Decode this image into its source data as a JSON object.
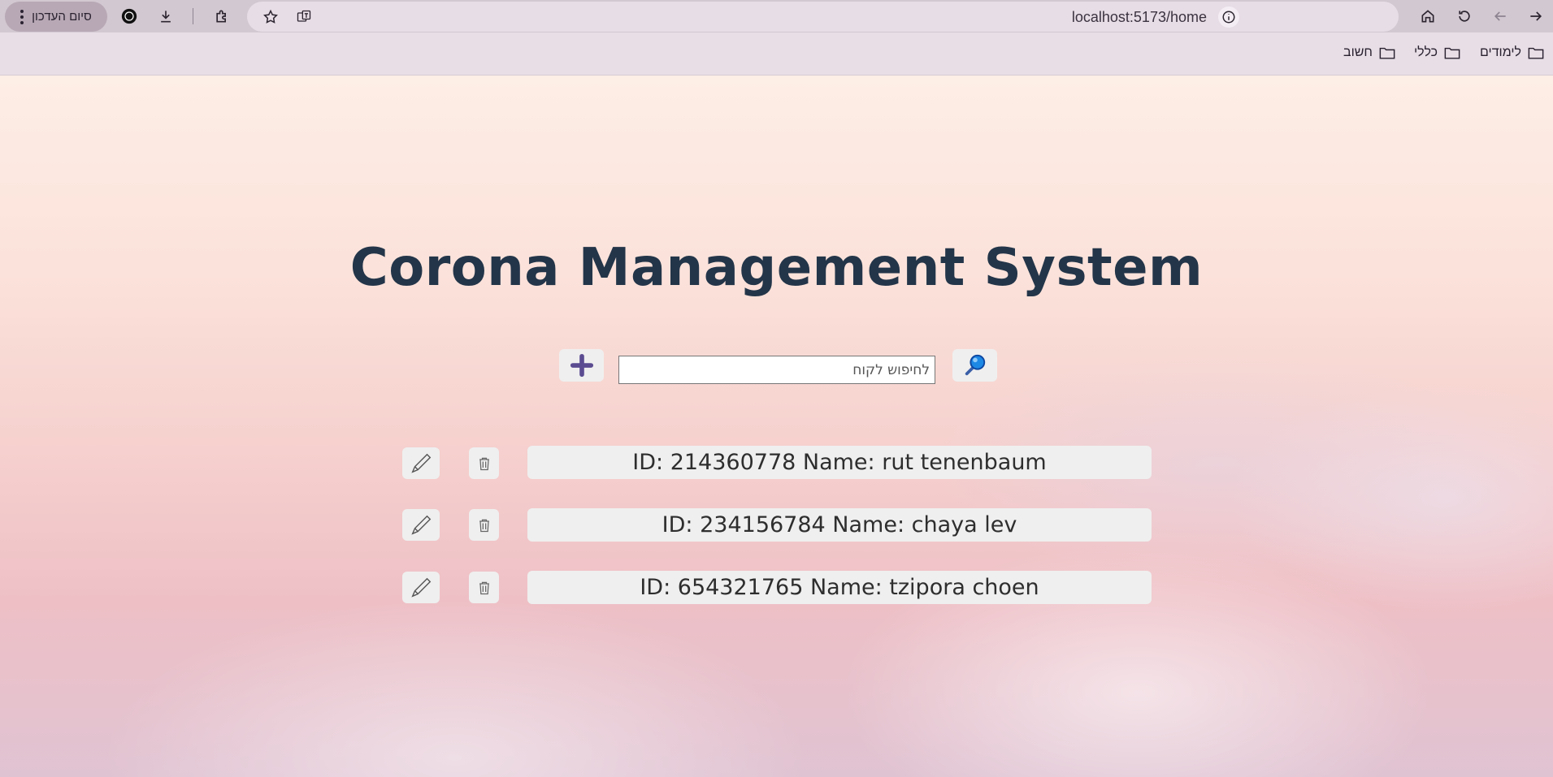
{
  "browser": {
    "url": "localhost:5173/home",
    "profile_button_label": "סיום העדכון",
    "bookmarks": [
      {
        "label": "לימודים"
      },
      {
        "label": "כללי"
      },
      {
        "label": "חשוב"
      }
    ]
  },
  "page": {
    "title": "Corona Management System",
    "search": {
      "placeholder": "לחיפוש לקוח",
      "value": ""
    },
    "add_button_icon": "plus-icon",
    "search_button_icon": "magnifier-icon",
    "customers": [
      {
        "text": "ID: 214360778 Name: rut tenenbaum"
      },
      {
        "text": "ID: 234156784 Name: chaya lev"
      },
      {
        "text": "ID: 654321765 Name: tzipora choen"
      }
    ],
    "row_actions": [
      "edit-pen-icon",
      "delete-trash-icon"
    ]
  },
  "colors": {
    "title": "#233549",
    "plus_icon": "#5b4c91",
    "magnifier_icon": "#1e88e5",
    "toolbar_bg": "#d2c8d1"
  }
}
